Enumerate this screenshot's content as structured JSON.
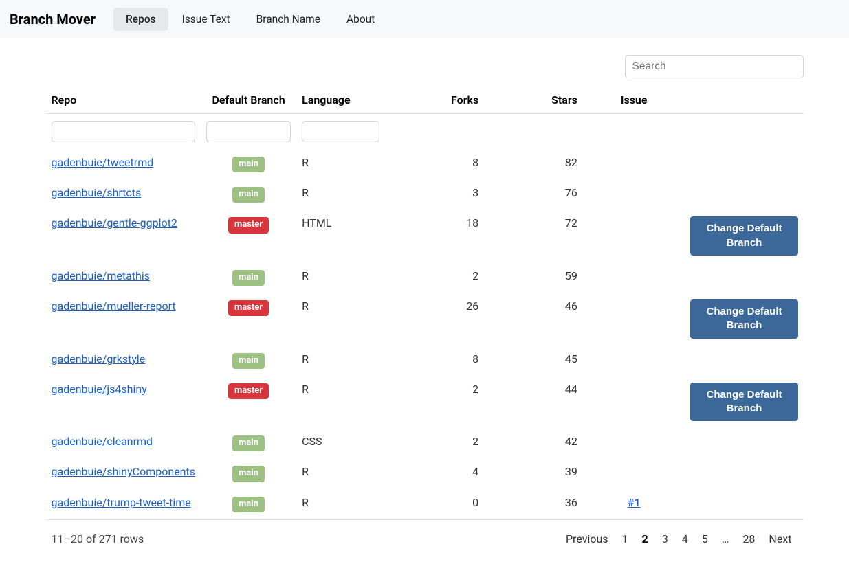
{
  "header": {
    "brand": "Branch Mover",
    "nav": [
      "Repos",
      "Issue Text",
      "Branch Name",
      "About"
    ],
    "active_nav_index": 0
  },
  "search": {
    "placeholder": "Search",
    "value": ""
  },
  "table": {
    "headers": {
      "repo": "Repo",
      "branch": "Default Branch",
      "language": "Language",
      "forks": "Forks",
      "stars": "Stars",
      "issue": "Issue"
    },
    "filters": {
      "repo": "",
      "branch": "",
      "language": ""
    },
    "change_button_label": "Change Default Branch",
    "rows": [
      {
        "repo": "gadenbuie/tweetrmd",
        "branch": "main",
        "language": "R",
        "forks": 8,
        "stars": 82,
        "issue": null,
        "action": null
      },
      {
        "repo": "gadenbuie/shrtcts",
        "branch": "main",
        "language": "R",
        "forks": 3,
        "stars": 76,
        "issue": null,
        "action": null
      },
      {
        "repo": "gadenbuie/gentle-ggplot2",
        "branch": "master",
        "language": "HTML",
        "forks": 18,
        "stars": 72,
        "issue": null,
        "action": "change"
      },
      {
        "repo": "gadenbuie/metathis",
        "branch": "main",
        "language": "R",
        "forks": 2,
        "stars": 59,
        "issue": null,
        "action": null
      },
      {
        "repo": "gadenbuie/mueller-report",
        "branch": "master",
        "language": "R",
        "forks": 26,
        "stars": 46,
        "issue": null,
        "action": "change"
      },
      {
        "repo": "gadenbuie/grkstyle",
        "branch": "main",
        "language": "R",
        "forks": 8,
        "stars": 45,
        "issue": null,
        "action": null
      },
      {
        "repo": "gadenbuie/js4shiny",
        "branch": "master",
        "language": "R",
        "forks": 2,
        "stars": 44,
        "issue": null,
        "action": "change"
      },
      {
        "repo": "gadenbuie/cleanrmd",
        "branch": "main",
        "language": "CSS",
        "forks": 2,
        "stars": 42,
        "issue": null,
        "action": null
      },
      {
        "repo": "gadenbuie/shinyComponents",
        "branch": "main",
        "language": "R",
        "forks": 4,
        "stars": 39,
        "issue": null,
        "action": null
      },
      {
        "repo": "gadenbuie/trump-tweet-time",
        "branch": "main",
        "language": "R",
        "forks": 0,
        "stars": 36,
        "issue": "#1",
        "action": null
      }
    ]
  },
  "footer": {
    "summary": "11–20 of 271 rows",
    "pagination": {
      "prev": "Previous",
      "next": "Next",
      "pages": [
        "1",
        "2",
        "3",
        "4",
        "5",
        "…",
        "28"
      ],
      "current_index": 1
    }
  }
}
